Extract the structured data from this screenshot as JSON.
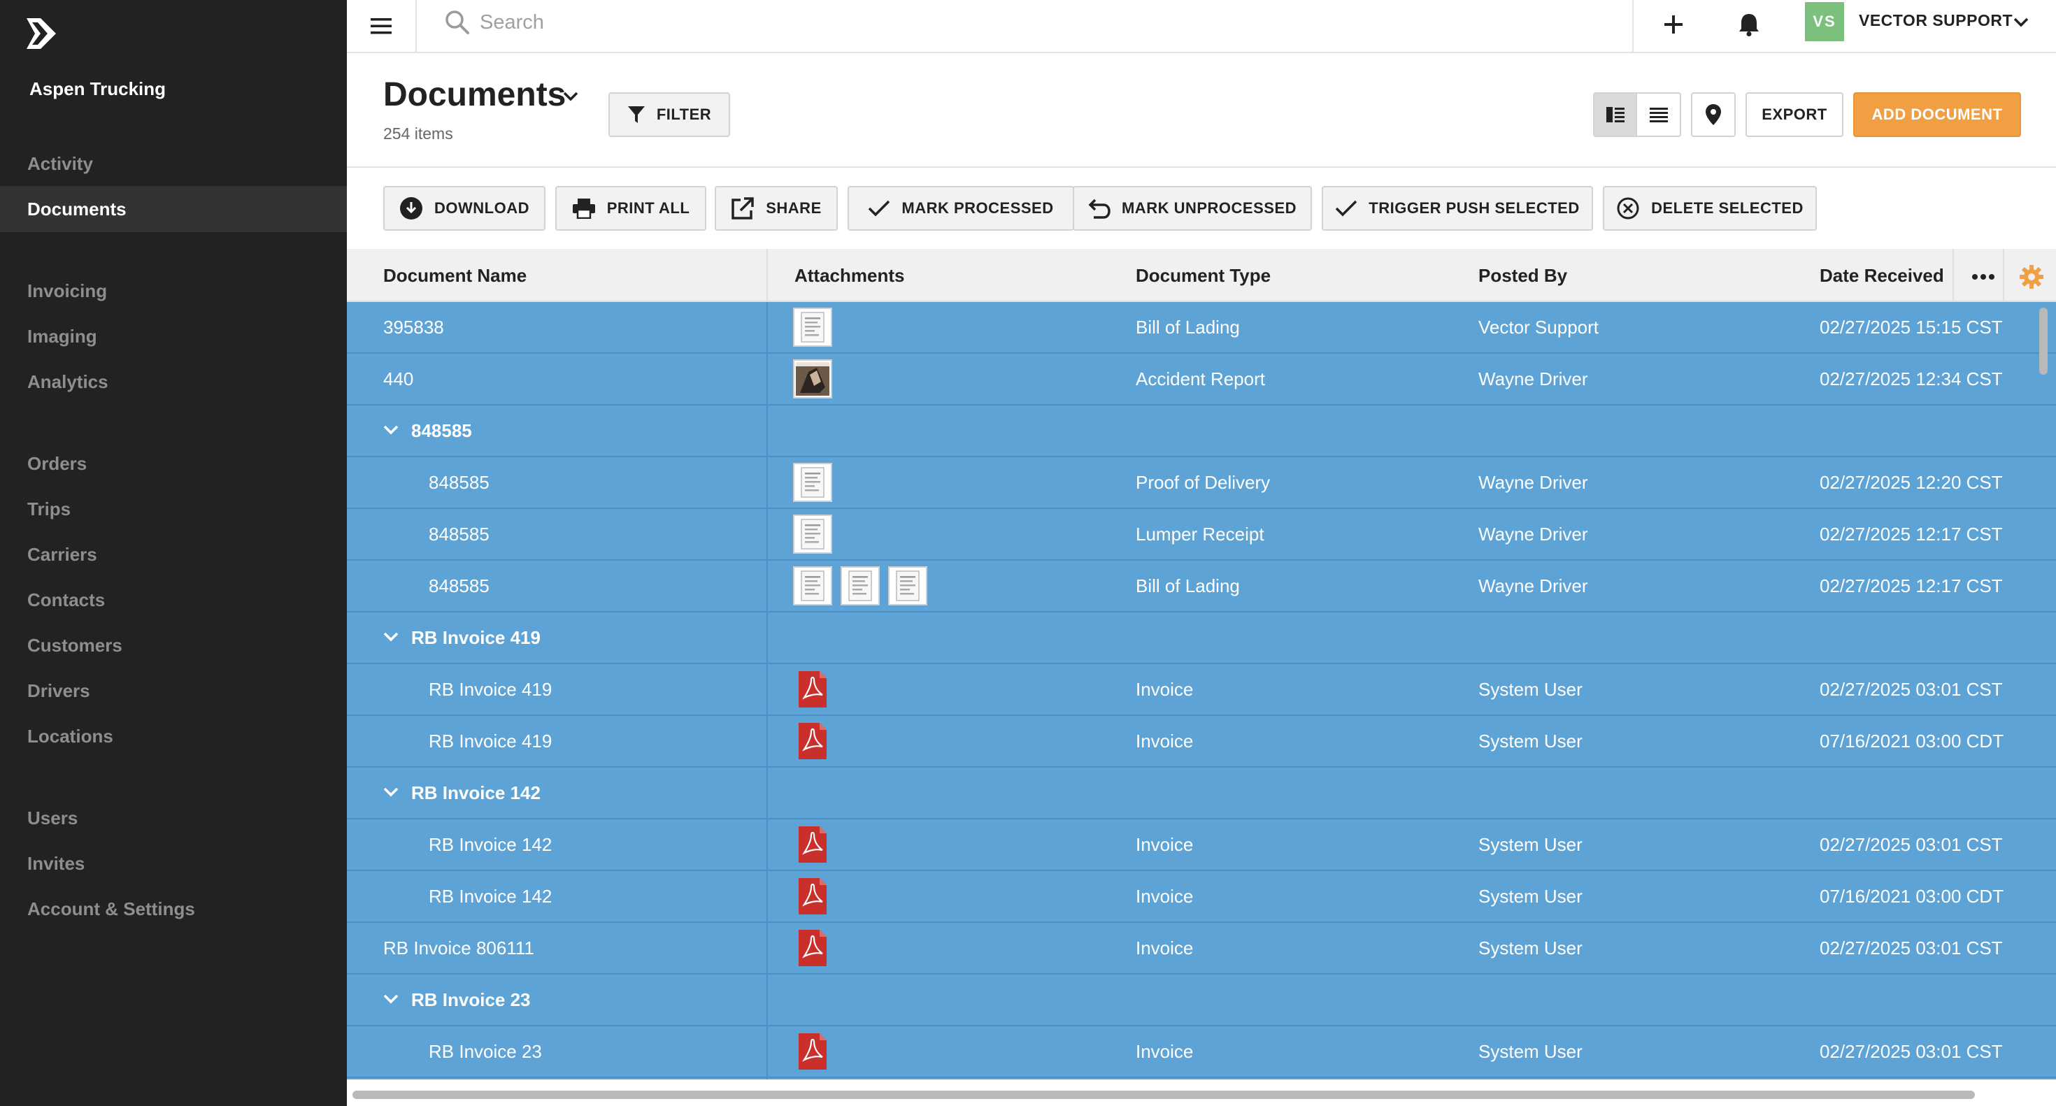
{
  "sidebar": {
    "company": "Aspen Trucking",
    "logo_icon": "brand-chevron-logo",
    "items": [
      {
        "label": "Activity"
      },
      {
        "label": "Documents",
        "active": true
      },
      {
        "label": "Invoicing"
      },
      {
        "label": "Imaging"
      },
      {
        "label": "Analytics"
      },
      {
        "label": "Orders"
      },
      {
        "label": "Trips"
      },
      {
        "label": "Carriers"
      },
      {
        "label": "Contacts"
      },
      {
        "label": "Customers"
      },
      {
        "label": "Drivers"
      },
      {
        "label": "Locations"
      },
      {
        "label": "Users"
      },
      {
        "label": "Invites"
      },
      {
        "label": "Account & Settings"
      }
    ]
  },
  "topbar": {
    "search_placeholder": "Search",
    "user_initials": "VS",
    "user_name": "VECTOR SUPPORT",
    "avatar_color": "#7cc07d"
  },
  "header": {
    "title": "Documents",
    "count": "254 items",
    "filter_label": "FILTER",
    "export_label": "EXPORT",
    "add_label": "ADD DOCUMENT",
    "add_color": "#f0a043"
  },
  "toolbar": {
    "download": "DOWNLOAD",
    "print_all": "PRINT ALL",
    "share": "SHARE",
    "mark_processed": "MARK PROCESSED",
    "mark_unprocessed": "MARK UNPROCESSED",
    "trigger_push": "TRIGGER PUSH SELECTED",
    "delete_selected": "DELETE SELECTED"
  },
  "grid": {
    "selection_color": "#5ea3d6",
    "columns": [
      "Document Name",
      "Attachments",
      "Document Type",
      "Posted By",
      "Date Received"
    ],
    "rows": [
      {
        "kind": "row",
        "indent": 0,
        "name": "395838",
        "attachments": [
          {
            "type": "doc"
          }
        ],
        "type": "Bill of Lading",
        "posted_by": "Vector Support",
        "date": "02/27/2025 15:15 CST"
      },
      {
        "kind": "row",
        "indent": 0,
        "name": "440",
        "attachments": [
          {
            "type": "photo"
          }
        ],
        "type": "Accident Report",
        "posted_by": "Wayne Driver",
        "date": "02/27/2025 12:34 CST"
      },
      {
        "kind": "group",
        "name": "848585"
      },
      {
        "kind": "row",
        "indent": 1,
        "name": "848585",
        "attachments": [
          {
            "type": "doc"
          }
        ],
        "type": "Proof of Delivery",
        "posted_by": "Wayne Driver",
        "date": "02/27/2025 12:20 CST"
      },
      {
        "kind": "row",
        "indent": 1,
        "name": "848585",
        "attachments": [
          {
            "type": "doc"
          }
        ],
        "type": "Lumper Receipt",
        "posted_by": "Wayne Driver",
        "date": "02/27/2025 12:17 CST"
      },
      {
        "kind": "row",
        "indent": 1,
        "name": "848585",
        "attachments": [
          {
            "type": "doc"
          },
          {
            "type": "doc"
          },
          {
            "type": "doc"
          }
        ],
        "type": "Bill of Lading",
        "posted_by": "Wayne Driver",
        "date": "02/27/2025 12:17 CST"
      },
      {
        "kind": "group",
        "name": "RB Invoice 419"
      },
      {
        "kind": "row",
        "indent": 1,
        "name": "RB Invoice 419",
        "attachments": [
          {
            "type": "pdf"
          }
        ],
        "type": "Invoice",
        "posted_by": "System User",
        "date": "02/27/2025 03:01 CST"
      },
      {
        "kind": "row",
        "indent": 1,
        "name": "RB Invoice 419",
        "attachments": [
          {
            "type": "pdf"
          }
        ],
        "type": "Invoice",
        "posted_by": "System User",
        "date": "07/16/2021 03:00 CDT"
      },
      {
        "kind": "group",
        "name": "RB Invoice 142"
      },
      {
        "kind": "row",
        "indent": 1,
        "name": "RB Invoice 142",
        "attachments": [
          {
            "type": "pdf"
          }
        ],
        "type": "Invoice",
        "posted_by": "System User",
        "date": "02/27/2025 03:01 CST"
      },
      {
        "kind": "row",
        "indent": 1,
        "name": "RB Invoice 142",
        "attachments": [
          {
            "type": "pdf"
          }
        ],
        "type": "Invoice",
        "posted_by": "System User",
        "date": "07/16/2021 03:00 CDT"
      },
      {
        "kind": "row",
        "indent": 0,
        "name": "RB Invoice 806111",
        "attachments": [
          {
            "type": "pdf"
          }
        ],
        "type": "Invoice",
        "posted_by": "System User",
        "date": "02/27/2025 03:01 CST"
      },
      {
        "kind": "group",
        "name": "RB Invoice 23"
      },
      {
        "kind": "row",
        "indent": 1,
        "name": "RB Invoice 23",
        "attachments": [
          {
            "type": "pdf"
          }
        ],
        "type": "Invoice",
        "posted_by": "System User",
        "date": "02/27/2025 03:01 CST"
      },
      {
        "kind": "row",
        "indent": 1,
        "name": "",
        "attachments": [
          {
            "type": "pdf"
          }
        ],
        "type": "",
        "posted_by": "",
        "date": ""
      }
    ]
  }
}
